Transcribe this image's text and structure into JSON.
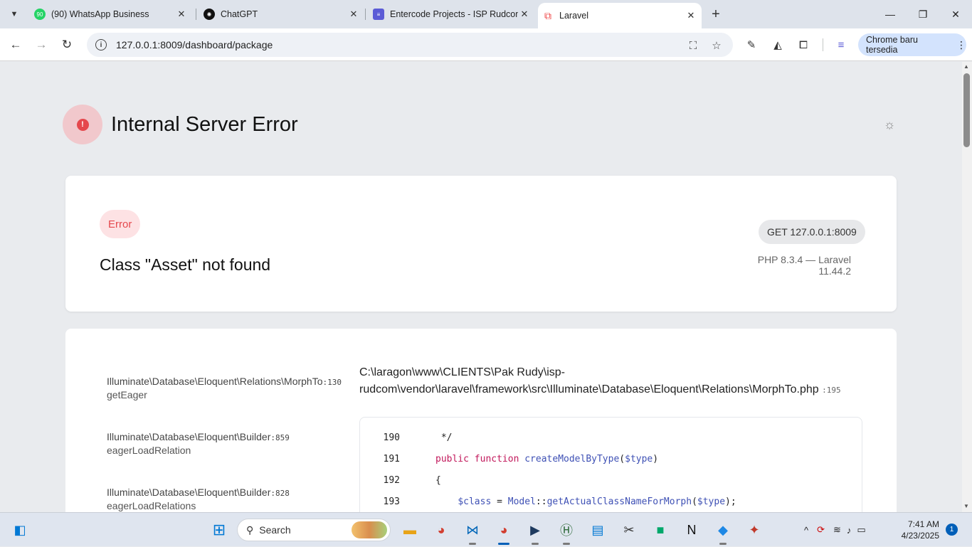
{
  "browser": {
    "tabs": [
      {
        "title": "(90) WhatsApp Business",
        "favicon_badge": "90",
        "color": "#25d366",
        "icon": "whatsapp-icon"
      },
      {
        "title": "ChatGPT",
        "color": "#000000",
        "icon": "chatgpt-icon"
      },
      {
        "title": "Entercode Projects - ISP Rudcom",
        "color": "#5b5bd6",
        "icon": "linear-icon"
      },
      {
        "title": "Laravel",
        "color": "#ef4444",
        "icon": "laravel-icon",
        "active": true
      }
    ],
    "url": "127.0.0.1:8009/dashboard/package",
    "update_label": "Chrome baru tersedia"
  },
  "error_page": {
    "title": "Internal Server Error",
    "badge": "Error",
    "message": "Class \"Asset\" not found",
    "request": "GET 127.0.0.1:8009",
    "versions": "PHP 8.3.4 — Laravel 11.44.2",
    "frames": [
      {
        "class": "Illuminate\\Database\\Eloquent\\Relations\\MorphTo",
        "line": ":130",
        "fn": "getEager"
      },
      {
        "class": "Illuminate\\Database\\Eloquent\\Builder",
        "line": ":859",
        "fn": "eagerLoadRelation"
      },
      {
        "class": "Illuminate\\Database\\Eloquent\\Builder",
        "line": ":828",
        "fn": "eagerLoadRelations"
      }
    ],
    "file_path_1": "C:\\laragon\\www\\CLIENTS\\Pak Rudy\\isp-",
    "file_path_2": "rudcom\\vendor\\laravel\\framework\\src\\Illuminate\\Database\\Eloquent\\Relations\\MorphTo.php",
    "file_line": ":195",
    "code": [
      {
        "num": "190",
        "text": " */"
      },
      {
        "num": "191",
        "text": "public function createModelByType($type)"
      },
      {
        "num": "192",
        "text": "{"
      },
      {
        "num": "193",
        "text": "    $class = Model::getActualClassNameForMorph($type);"
      }
    ]
  },
  "taskbar": {
    "search_placeholder": "Search",
    "time": "7:41 AM",
    "date": "4/23/2025",
    "notifications": "1"
  }
}
